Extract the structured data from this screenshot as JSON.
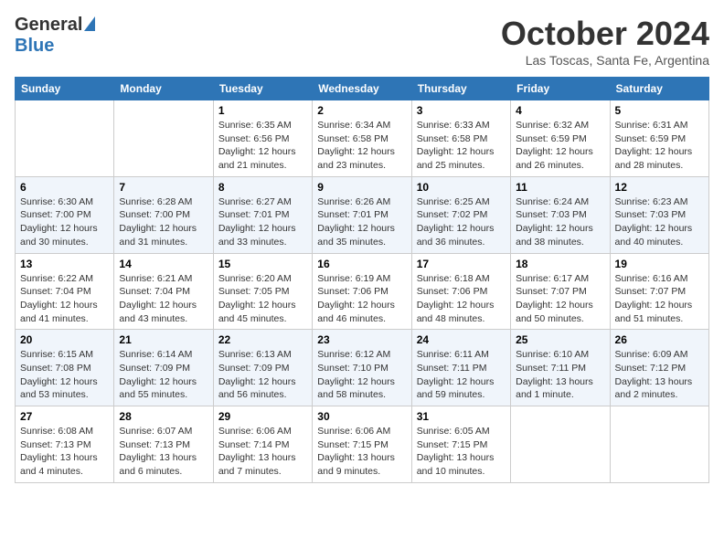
{
  "header": {
    "logo_general": "General",
    "logo_blue": "Blue",
    "month_title": "October 2024",
    "location": "Las Toscas, Santa Fe, Argentina"
  },
  "calendar": {
    "days_of_week": [
      "Sunday",
      "Monday",
      "Tuesday",
      "Wednesday",
      "Thursday",
      "Friday",
      "Saturday"
    ],
    "weeks": [
      [
        {
          "day": "",
          "info": ""
        },
        {
          "day": "",
          "info": ""
        },
        {
          "day": "1",
          "info": "Sunrise: 6:35 AM\nSunset: 6:56 PM\nDaylight: 12 hours\nand 21 minutes."
        },
        {
          "day": "2",
          "info": "Sunrise: 6:34 AM\nSunset: 6:58 PM\nDaylight: 12 hours\nand 23 minutes."
        },
        {
          "day": "3",
          "info": "Sunrise: 6:33 AM\nSunset: 6:58 PM\nDaylight: 12 hours\nand 25 minutes."
        },
        {
          "day": "4",
          "info": "Sunrise: 6:32 AM\nSunset: 6:59 PM\nDaylight: 12 hours\nand 26 minutes."
        },
        {
          "day": "5",
          "info": "Sunrise: 6:31 AM\nSunset: 6:59 PM\nDaylight: 12 hours\nand 28 minutes."
        }
      ],
      [
        {
          "day": "6",
          "info": "Sunrise: 6:30 AM\nSunset: 7:00 PM\nDaylight: 12 hours\nand 30 minutes."
        },
        {
          "day": "7",
          "info": "Sunrise: 6:28 AM\nSunset: 7:00 PM\nDaylight: 12 hours\nand 31 minutes."
        },
        {
          "day": "8",
          "info": "Sunrise: 6:27 AM\nSunset: 7:01 PM\nDaylight: 12 hours\nand 33 minutes."
        },
        {
          "day": "9",
          "info": "Sunrise: 6:26 AM\nSunset: 7:01 PM\nDaylight: 12 hours\nand 35 minutes."
        },
        {
          "day": "10",
          "info": "Sunrise: 6:25 AM\nSunset: 7:02 PM\nDaylight: 12 hours\nand 36 minutes."
        },
        {
          "day": "11",
          "info": "Sunrise: 6:24 AM\nSunset: 7:03 PM\nDaylight: 12 hours\nand 38 minutes."
        },
        {
          "day": "12",
          "info": "Sunrise: 6:23 AM\nSunset: 7:03 PM\nDaylight: 12 hours\nand 40 minutes."
        }
      ],
      [
        {
          "day": "13",
          "info": "Sunrise: 6:22 AM\nSunset: 7:04 PM\nDaylight: 12 hours\nand 41 minutes."
        },
        {
          "day": "14",
          "info": "Sunrise: 6:21 AM\nSunset: 7:04 PM\nDaylight: 12 hours\nand 43 minutes."
        },
        {
          "day": "15",
          "info": "Sunrise: 6:20 AM\nSunset: 7:05 PM\nDaylight: 12 hours\nand 45 minutes."
        },
        {
          "day": "16",
          "info": "Sunrise: 6:19 AM\nSunset: 7:06 PM\nDaylight: 12 hours\nand 46 minutes."
        },
        {
          "day": "17",
          "info": "Sunrise: 6:18 AM\nSunset: 7:06 PM\nDaylight: 12 hours\nand 48 minutes."
        },
        {
          "day": "18",
          "info": "Sunrise: 6:17 AM\nSunset: 7:07 PM\nDaylight: 12 hours\nand 50 minutes."
        },
        {
          "day": "19",
          "info": "Sunrise: 6:16 AM\nSunset: 7:07 PM\nDaylight: 12 hours\nand 51 minutes."
        }
      ],
      [
        {
          "day": "20",
          "info": "Sunrise: 6:15 AM\nSunset: 7:08 PM\nDaylight: 12 hours\nand 53 minutes."
        },
        {
          "day": "21",
          "info": "Sunrise: 6:14 AM\nSunset: 7:09 PM\nDaylight: 12 hours\nand 55 minutes."
        },
        {
          "day": "22",
          "info": "Sunrise: 6:13 AM\nSunset: 7:09 PM\nDaylight: 12 hours\nand 56 minutes."
        },
        {
          "day": "23",
          "info": "Sunrise: 6:12 AM\nSunset: 7:10 PM\nDaylight: 12 hours\nand 58 minutes."
        },
        {
          "day": "24",
          "info": "Sunrise: 6:11 AM\nSunset: 7:11 PM\nDaylight: 12 hours\nand 59 minutes."
        },
        {
          "day": "25",
          "info": "Sunrise: 6:10 AM\nSunset: 7:11 PM\nDaylight: 13 hours\nand 1 minute."
        },
        {
          "day": "26",
          "info": "Sunrise: 6:09 AM\nSunset: 7:12 PM\nDaylight: 13 hours\nand 2 minutes."
        }
      ],
      [
        {
          "day": "27",
          "info": "Sunrise: 6:08 AM\nSunset: 7:13 PM\nDaylight: 13 hours\nand 4 minutes."
        },
        {
          "day": "28",
          "info": "Sunrise: 6:07 AM\nSunset: 7:13 PM\nDaylight: 13 hours\nand 6 minutes."
        },
        {
          "day": "29",
          "info": "Sunrise: 6:06 AM\nSunset: 7:14 PM\nDaylight: 13 hours\nand 7 minutes."
        },
        {
          "day": "30",
          "info": "Sunrise: 6:06 AM\nSunset: 7:15 PM\nDaylight: 13 hours\nand 9 minutes."
        },
        {
          "day": "31",
          "info": "Sunrise: 6:05 AM\nSunset: 7:15 PM\nDaylight: 13 hours\nand 10 minutes."
        },
        {
          "day": "",
          "info": ""
        },
        {
          "day": "",
          "info": ""
        }
      ]
    ]
  }
}
